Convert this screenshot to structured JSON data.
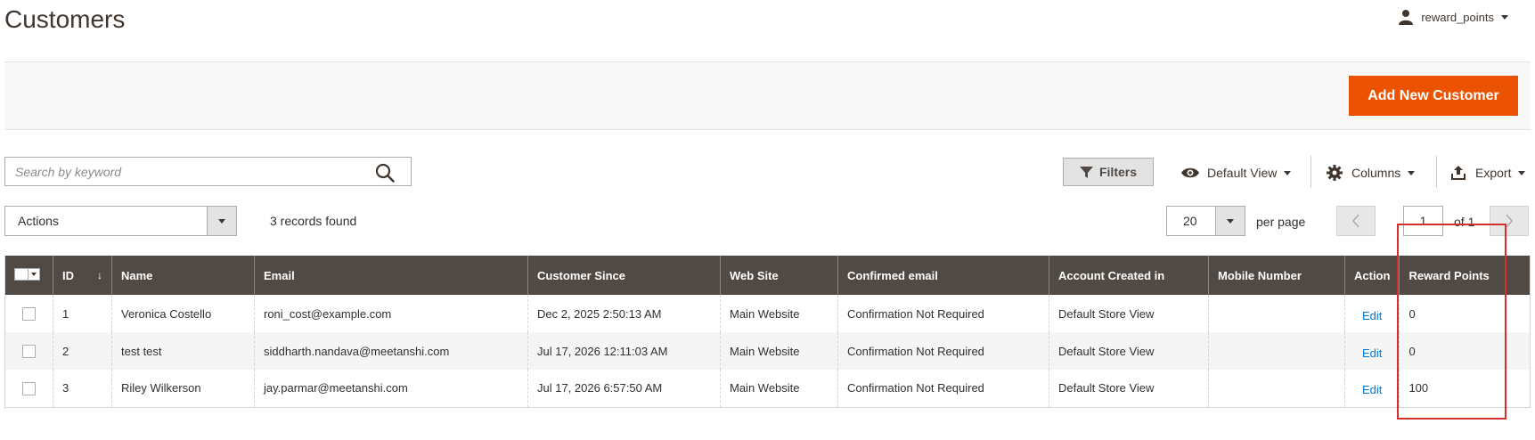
{
  "page": {
    "title": "Customers"
  },
  "user": {
    "name": "reward_points",
    "icon": "user-icon"
  },
  "toolbar": {
    "add_label": "Add New Customer"
  },
  "search": {
    "placeholder": "Search by keyword",
    "value": ""
  },
  "controls": {
    "filters_label": "Filters",
    "view_label": "Default View",
    "columns_label": "Columns",
    "export_label": "Export"
  },
  "mass_actions": {
    "label": "Actions"
  },
  "records": {
    "text": "3 records found"
  },
  "pager": {
    "per_page": "20",
    "per_page_label": "per page",
    "current_page": "1",
    "of_label": "of 1"
  },
  "grid": {
    "columns": {
      "id": "ID",
      "name": "Name",
      "email": "Email",
      "customer_since": "Customer Since",
      "website": "Web Site",
      "confirmed_email": "Confirmed email",
      "account_created_in": "Account Created in",
      "mobile": "Mobile Number",
      "action": "Action",
      "reward_points": "Reward Points"
    },
    "rows": [
      {
        "id": "1",
        "name": "Veronica Costello",
        "email": "roni_cost@example.com",
        "customer_since": "Dec 2, 2025 2:50:13 AM",
        "website": "Main Website",
        "confirmed_email": "Confirmation Not Required",
        "account_created_in": "Default Store View",
        "mobile": "",
        "action": "Edit",
        "reward_points": "0"
      },
      {
        "id": "2",
        "name": "test test",
        "email": "siddharth.nandava@meetanshi.com",
        "customer_since": "Jul 17, 2026 12:11:03 AM",
        "website": "Main Website",
        "confirmed_email": "Confirmation Not Required",
        "account_created_in": "Default Store View",
        "mobile": "",
        "action": "Edit",
        "reward_points": "0"
      },
      {
        "id": "3",
        "name": "Riley Wilkerson",
        "email": "jay.parmar@meetanshi.com",
        "customer_since": "Jul 17, 2026 6:57:50 AM",
        "website": "Main Website",
        "confirmed_email": "Confirmation Not Required",
        "account_created_in": "Default Store View",
        "mobile": "",
        "action": "Edit",
        "reward_points": "100"
      }
    ]
  },
  "colors": {
    "accent": "#eb5202",
    "header_bg": "#514943",
    "link": "#007bdb",
    "highlight": "#d32f2f"
  }
}
